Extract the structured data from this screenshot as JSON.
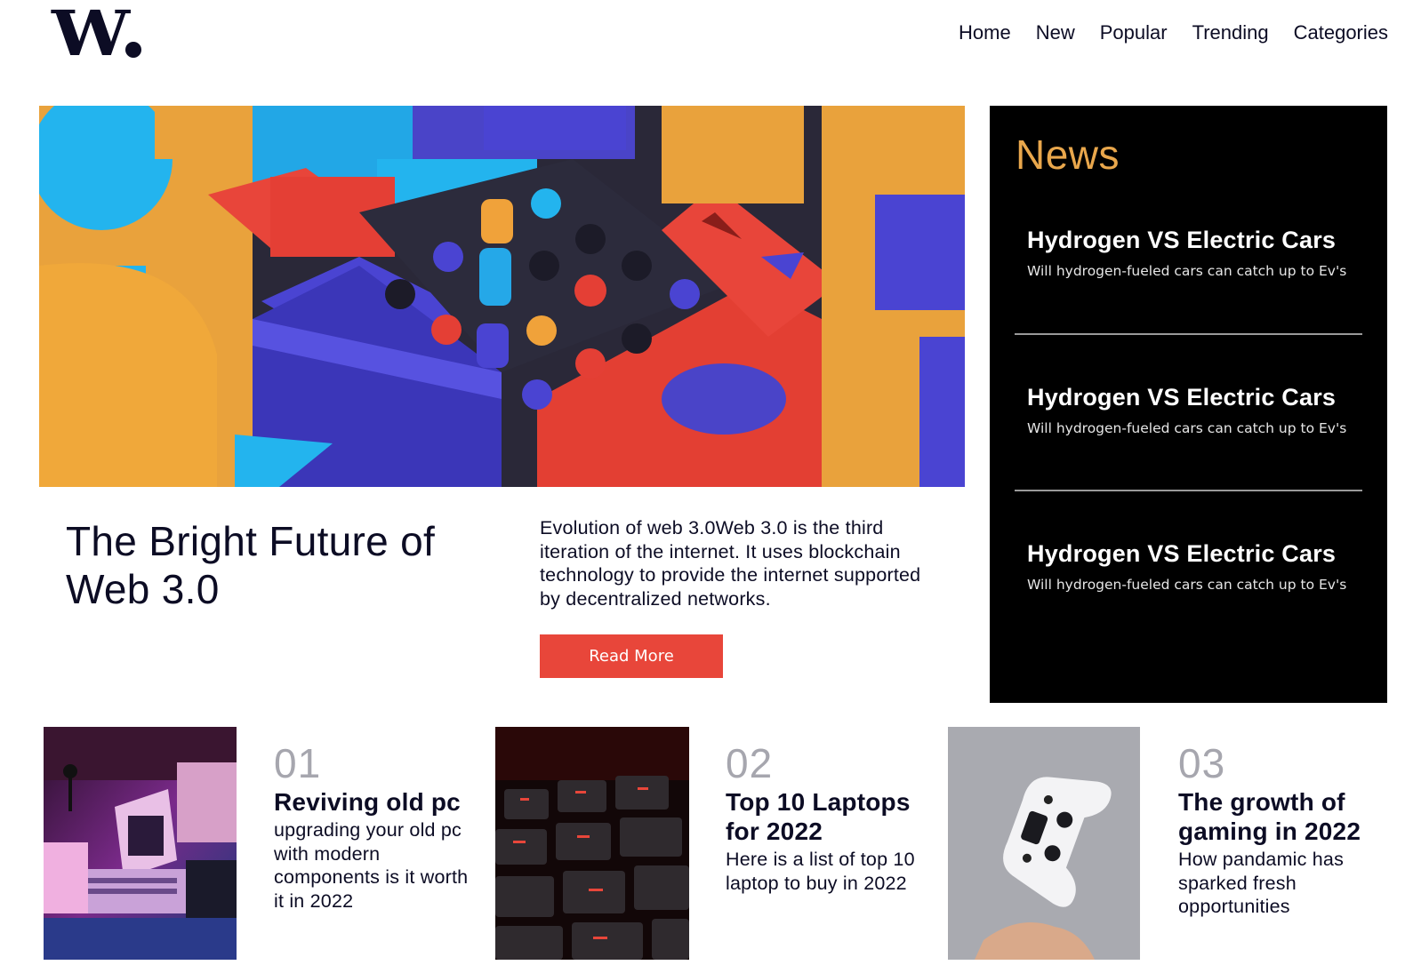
{
  "brand": {
    "logo_text": "W"
  },
  "nav": {
    "items": [
      "Home",
      "New",
      "Popular",
      "Trending",
      "Categories"
    ]
  },
  "hero": {
    "title": "The Bright Future of Web 3.0",
    "description": "Evolution of web 3.0Web 3.0 is the third iteration of the internet. It uses blockchain technology to provide the internet supported by decentralized networks.",
    "button_label": "Read More"
  },
  "news": {
    "heading": "News",
    "items": [
      {
        "title": "Hydrogen VS Electric Cars",
        "subtitle": "Will hydrogen-fueled cars can catch up to Ev's"
      },
      {
        "title": "Hydrogen VS Electric Cars",
        "subtitle": "Will hydrogen-fueled cars can catch up to Ev's"
      },
      {
        "title": "Hydrogen VS Electric Cars",
        "subtitle": "Will hydrogen-fueled cars can catch up to Ev's"
      }
    ]
  },
  "cards": [
    {
      "number": "01",
      "title": "Reviving old pc",
      "description": "upgrading your old pc with modern components is it worth it in 2022"
    },
    {
      "number": "02",
      "title": "Top 10 Laptops for 2022",
      "description": "Here is a list of top 10 laptop to buy in 2022"
    },
    {
      "number": "03",
      "title": "The growth of gaming in 2022",
      "description": "How pandamic has sparked fresh opportunities"
    }
  ],
  "colors": {
    "accent_red": "#e8463a",
    "news_heading_gold": "#e9a74c",
    "text_dark": "#0c0c24",
    "muted_number": "#a6a6ae",
    "news_bg": "#000000"
  }
}
